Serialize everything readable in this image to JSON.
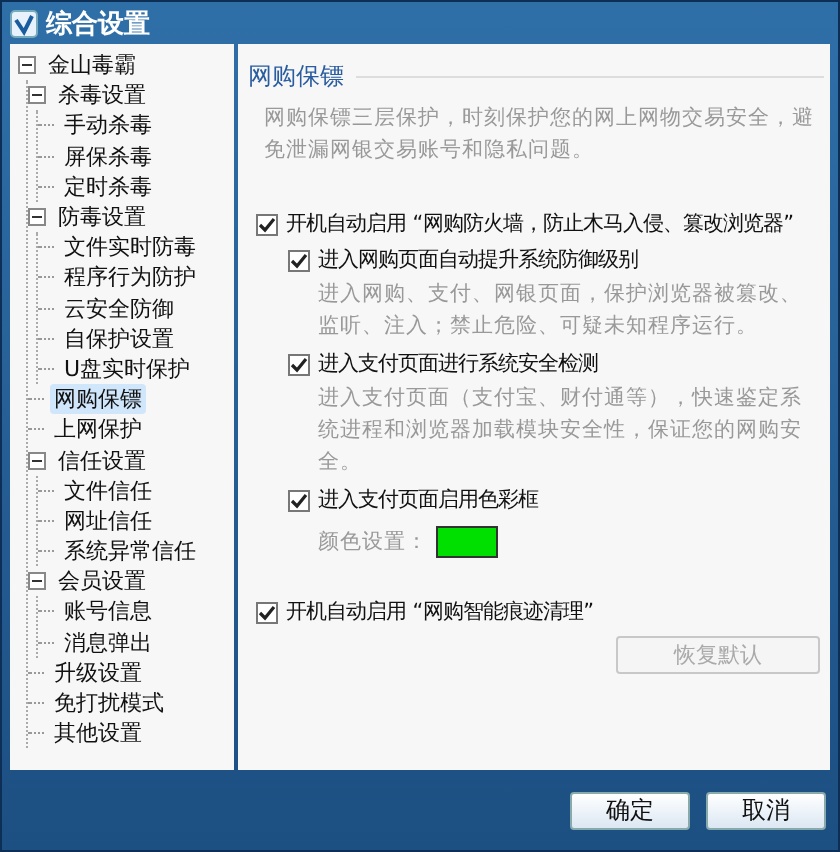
{
  "window": {
    "title": "综合设置"
  },
  "tree": [
    {
      "label": "金山毒霸",
      "expanded": true,
      "selected": false,
      "children": [
        {
          "label": "杀毒设置",
          "expanded": true,
          "selected": false,
          "children": [
            {
              "label": "手动杀毒",
              "selected": false
            },
            {
              "label": "屏保杀毒",
              "selected": false
            },
            {
              "label": "定时杀毒",
              "selected": false
            }
          ]
        },
        {
          "label": "防毒设置",
          "expanded": true,
          "selected": false,
          "children": [
            {
              "label": "文件实时防毒",
              "selected": false
            },
            {
              "label": "程序行为防护",
              "selected": false
            },
            {
              "label": "云安全防御",
              "selected": false
            },
            {
              "label": "自保护设置",
              "selected": false
            },
            {
              "label": "U盘实时保护",
              "selected": false
            }
          ]
        },
        {
          "label": "网购保镖",
          "selected": true
        },
        {
          "label": "上网保护",
          "selected": false
        },
        {
          "label": "信任设置",
          "expanded": true,
          "selected": false,
          "children": [
            {
              "label": "文件信任",
              "selected": false
            },
            {
              "label": "网址信任",
              "selected": false
            },
            {
              "label": "系统异常信任",
              "selected": false
            }
          ]
        },
        {
          "label": "会员设置",
          "expanded": true,
          "selected": false,
          "children": [
            {
              "label": "账号信息",
              "selected": false
            },
            {
              "label": "消息弹出",
              "selected": false
            }
          ]
        },
        {
          "label": "升级设置",
          "selected": false
        },
        {
          "label": "免打扰模式",
          "selected": false
        },
        {
          "label": "其他设置",
          "selected": false
        }
      ]
    }
  ],
  "panel": {
    "title": "网购保镖",
    "description": "网购保镖三层保护，时刻保护您的网上网物交易安全，避免泄漏网银交易账号和隐私问题。",
    "options": [
      {
        "label": "开机自动启用 “网购防火墙，防止木马入侵、篡改浏览器”",
        "checked": true,
        "children": [
          {
            "label": "进入网购页面自动提升系统防御级别",
            "checked": true,
            "description": "进入网购、支付、网银页面，保护浏览器被篡改、监听、注入；禁止危险、可疑未知程序运行。"
          },
          {
            "label": "进入支付页面进行系统安全检测",
            "checked": true,
            "description": "进入支付页面（支付宝、财付通等），快速鉴定系统进程和浏览器加载模块安全性，保证您的网购安全。"
          },
          {
            "label": "进入支付页面启用色彩框",
            "checked": true,
            "color_setting": {
              "label": "颜色设置：",
              "color": "#00e000"
            }
          }
        ]
      },
      {
        "label": "开机自动启用 “网购智能痕迹清理”",
        "checked": true
      }
    ],
    "restore_button": {
      "label": "恢复默认",
      "disabled": true
    }
  },
  "buttons": [
    "确定",
    "取消"
  ]
}
